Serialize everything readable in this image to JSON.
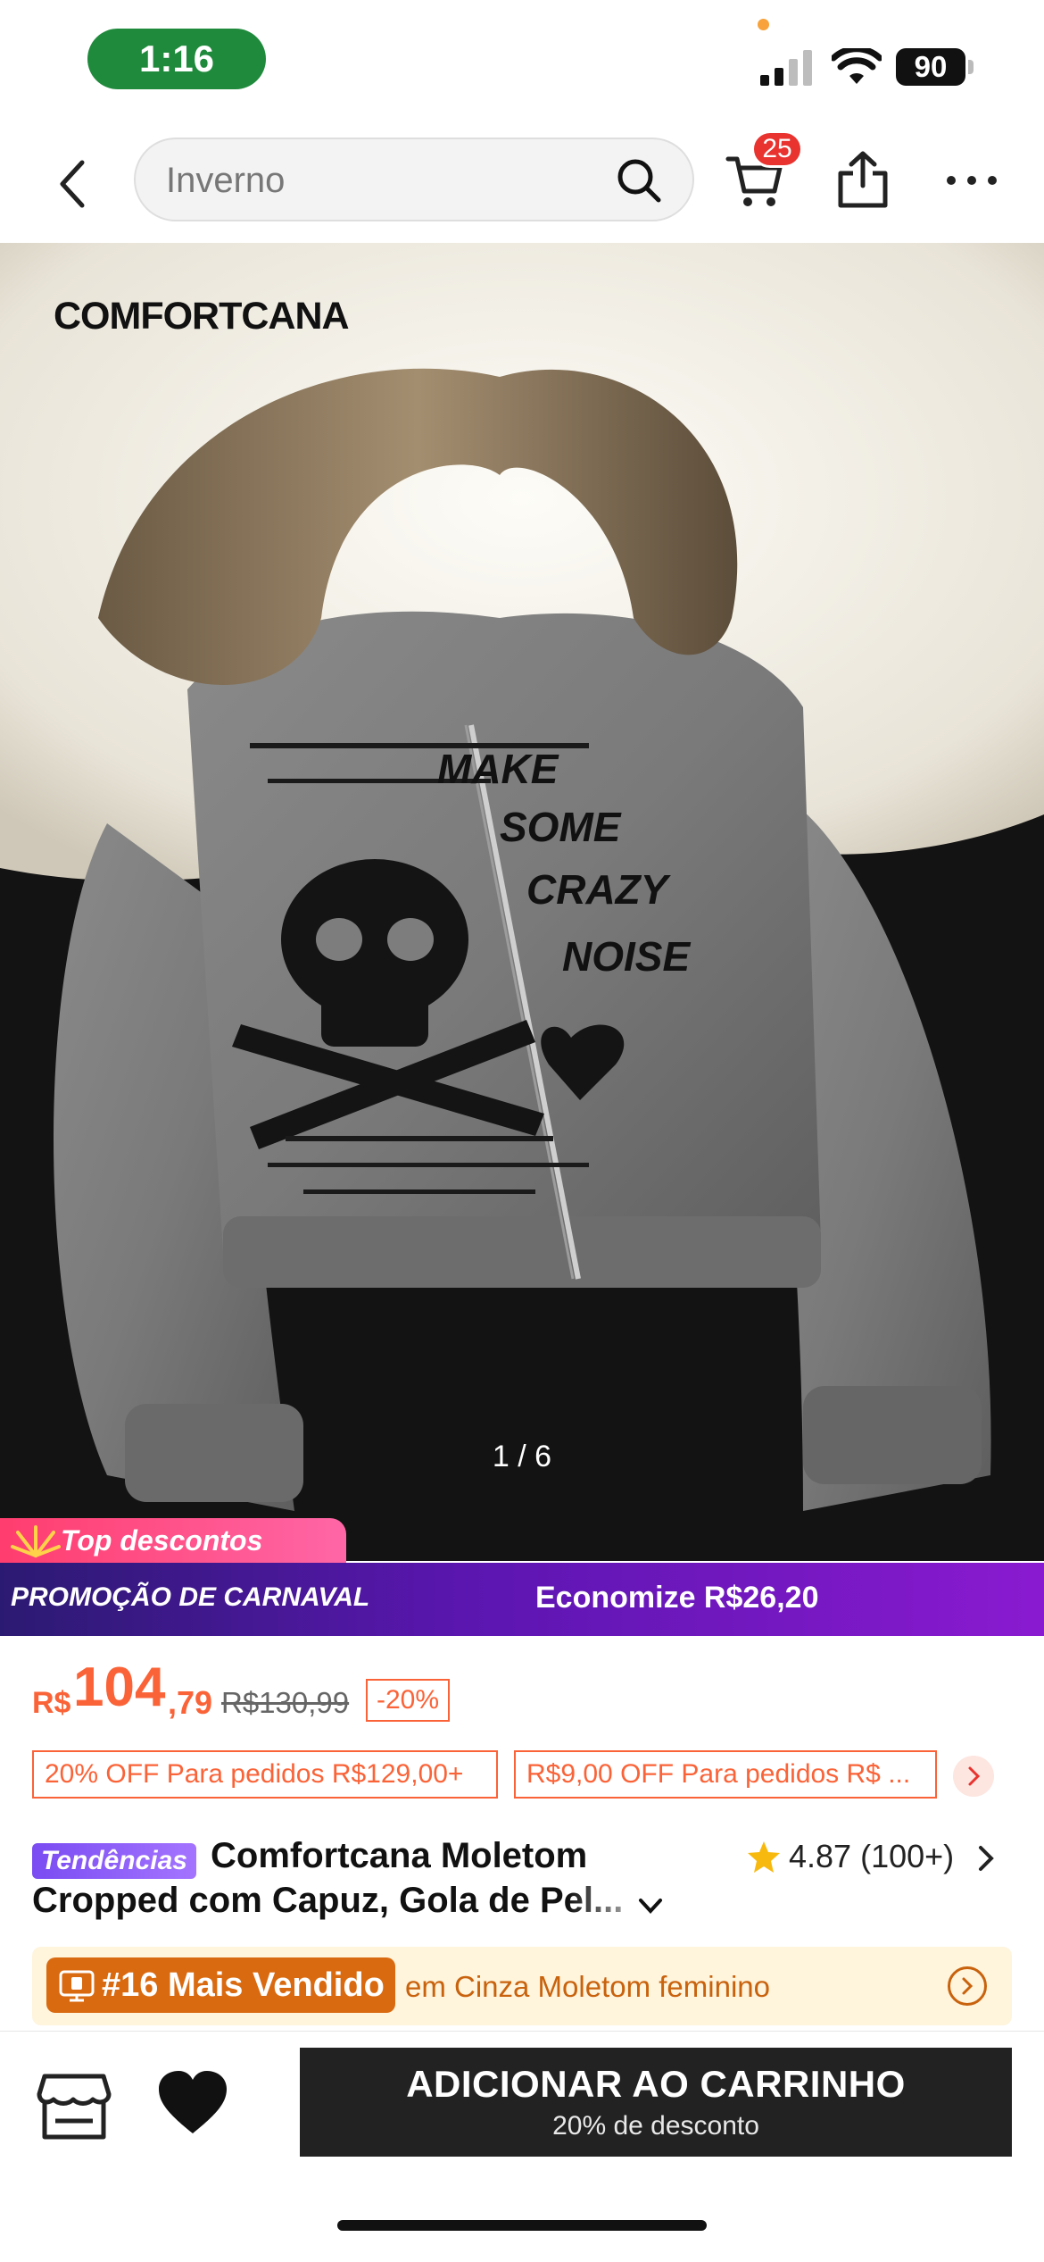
{
  "status_bar": {
    "time": "1:16",
    "battery": "90"
  },
  "nav": {
    "search_text": "Inverno",
    "cart_count": "25"
  },
  "product": {
    "brand": "COMFORTCANA",
    "image_counter": "1 / 6",
    "graphic_text": [
      "MAKE",
      "SOME",
      "CRAZY",
      "NOISE"
    ]
  },
  "promo": {
    "tag": "Top descontos",
    "carnival": "PROMOÇÃO DE CARNAVAL",
    "savings": "Economize R$26,20"
  },
  "price": {
    "currency": "R$",
    "integer": "104",
    "decimal": ",79",
    "original": "R$130,99",
    "discount": "-20%"
  },
  "coupons": [
    "20% OFF Para pedidos R$129,00+",
    "R$9,00 OFF Para pedidos R$ ..."
  ],
  "title": {
    "tag": "Tendências",
    "line1": "Comfortcana Moletom",
    "line2": "Cropped com Capuz, Gola de Pel..."
  },
  "rating": {
    "value": "4.87",
    "count": "(100+)"
  },
  "bestseller": {
    "rank": "#16 Mais Vendido",
    "category": "em Cinza Moletom feminino"
  },
  "bottom": {
    "add_to_cart": "ADICIONAR AO CARRINHO",
    "add_to_cart_sub": "20% de desconto"
  },
  "colors": {
    "accent": "#fa6338",
    "carnival_start": "#2b1a72",
    "carnival_end": "#8a1ad0",
    "bestseller_bg": "#fff4dc",
    "rank_tag": "#d96a10"
  }
}
